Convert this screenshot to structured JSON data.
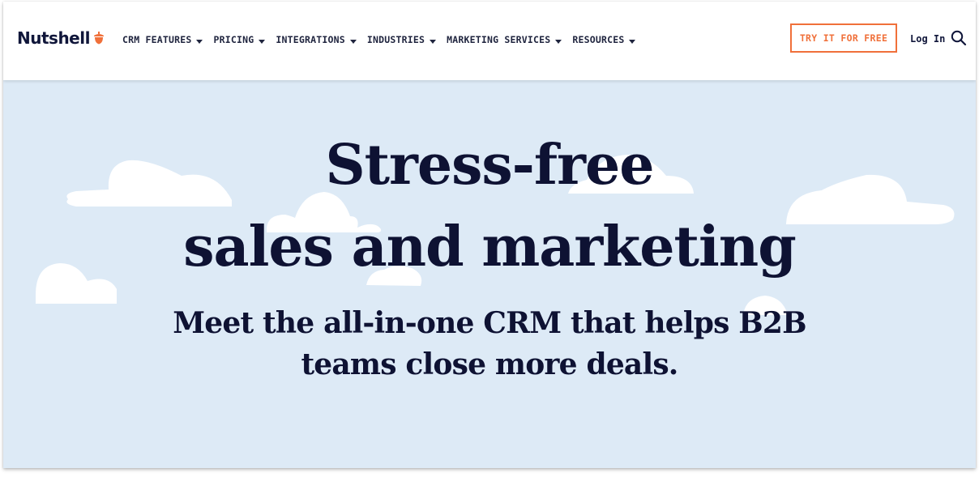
{
  "brand": {
    "name": "Nutshell",
    "logo_icon": "acorn-icon",
    "accent_color": "#f0703a",
    "text_color": "#10163a"
  },
  "nav": {
    "items": [
      {
        "label": "CRM FEATURES",
        "icon": "chevron-down-icon"
      },
      {
        "label": "PRICING",
        "icon": "chevron-down-icon"
      },
      {
        "label": "INTEGRATIONS",
        "icon": "chevron-down-icon"
      },
      {
        "label": "INDUSTRIES",
        "icon": "chevron-down-icon"
      },
      {
        "label": "MARKETING SERVICES",
        "icon": "chevron-down-icon"
      },
      {
        "label": "RESOURCES",
        "icon": "chevron-down-icon"
      }
    ],
    "cta_label": "TRY IT FOR FREE",
    "login_label": "Log In",
    "search_icon": "search-icon"
  },
  "hero": {
    "headline_line1": "Stress-free",
    "headline_line2": "sales and marketing",
    "subheadline_line1": "Meet the all-in-one CRM that helps B2B",
    "subheadline_line2": "teams close more deals.",
    "background_color": "#ddeaf6"
  }
}
